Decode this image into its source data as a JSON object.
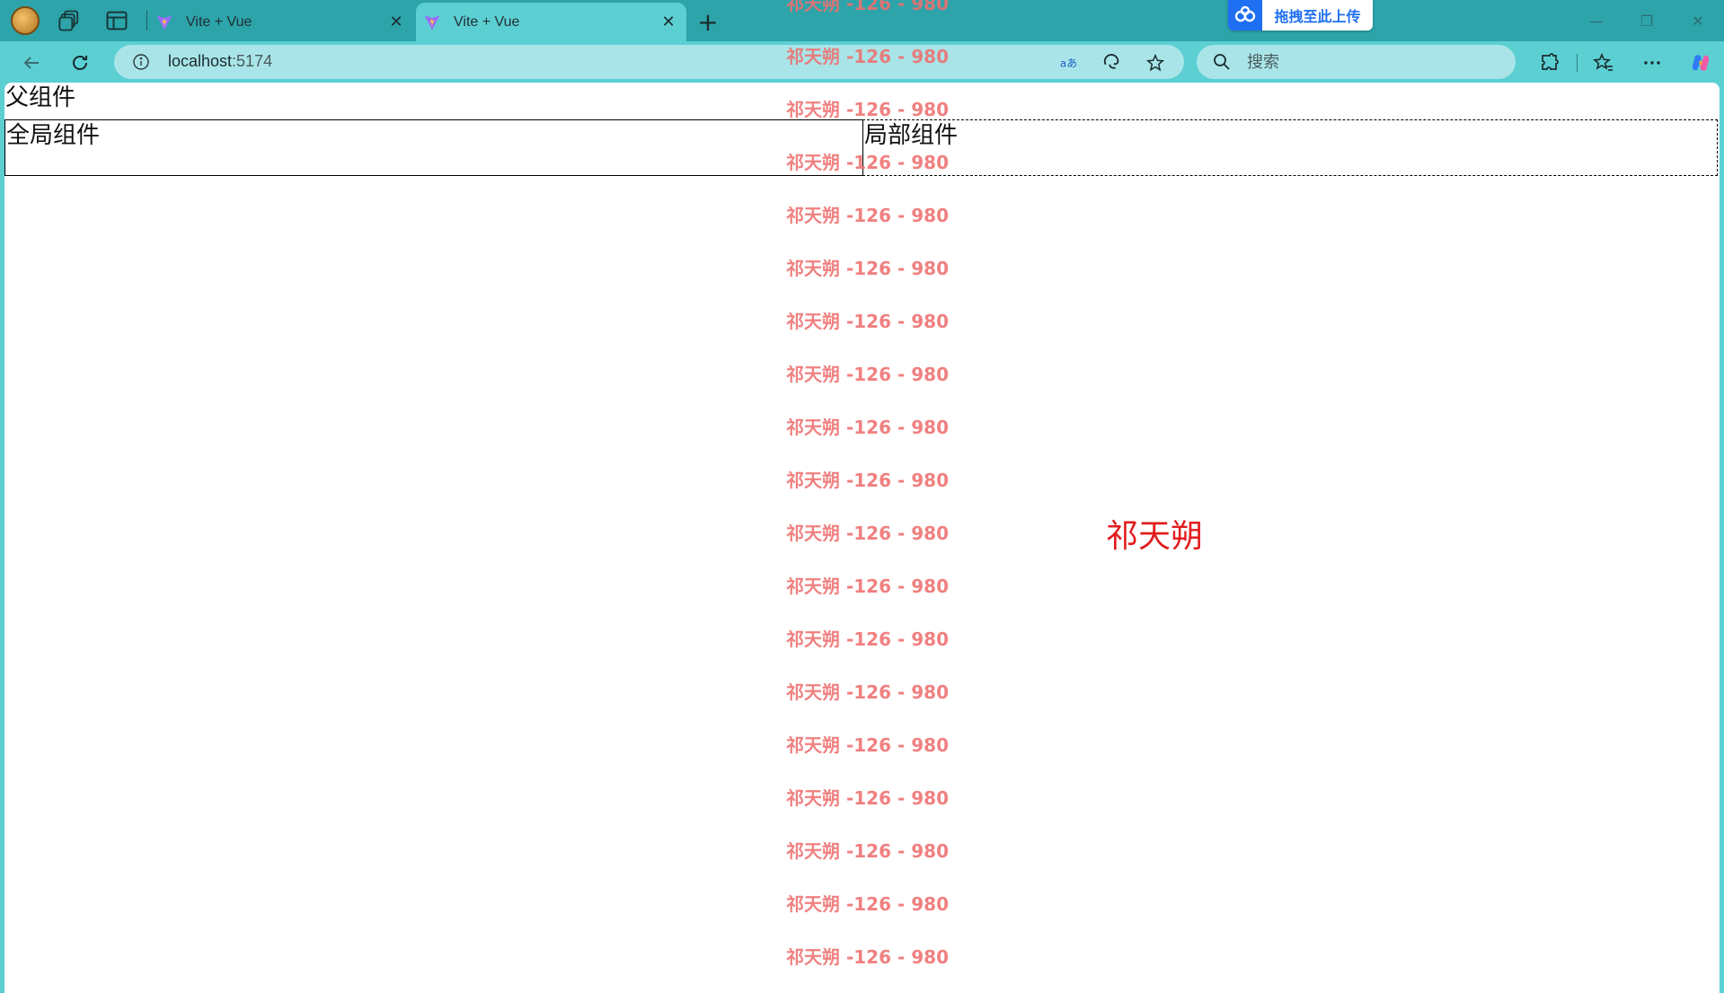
{
  "tabs": [
    {
      "title": "Vite + Vue",
      "active": false
    },
    {
      "title": "Vite + Vue",
      "active": true
    }
  ],
  "tab_close_glyph": "✕",
  "new_tab_glyph": "+",
  "upload_widget": {
    "label": "拖拽至此上传",
    "brand_color": "#1e6ff1"
  },
  "window_controls": {
    "minimize": "—",
    "restore": "❐",
    "close": "✕"
  },
  "address": {
    "host": "localhost",
    "port": ":5174"
  },
  "search": {
    "placeholder": "搜索"
  },
  "page": {
    "parent_title": "父组件",
    "global_component": "全局组件",
    "local_component": "局部组件",
    "name_label": "祁天朔",
    "name_color": "#e21c1c"
  },
  "watermark": {
    "text": "祁天朔 -126 - 980",
    "color": "#ef6f6f",
    "repeat_count": 19
  },
  "theme": {
    "frame": "#5ccfd3",
    "tabstrip": "#2da4aa",
    "omnibox": "#a9e5e8"
  }
}
